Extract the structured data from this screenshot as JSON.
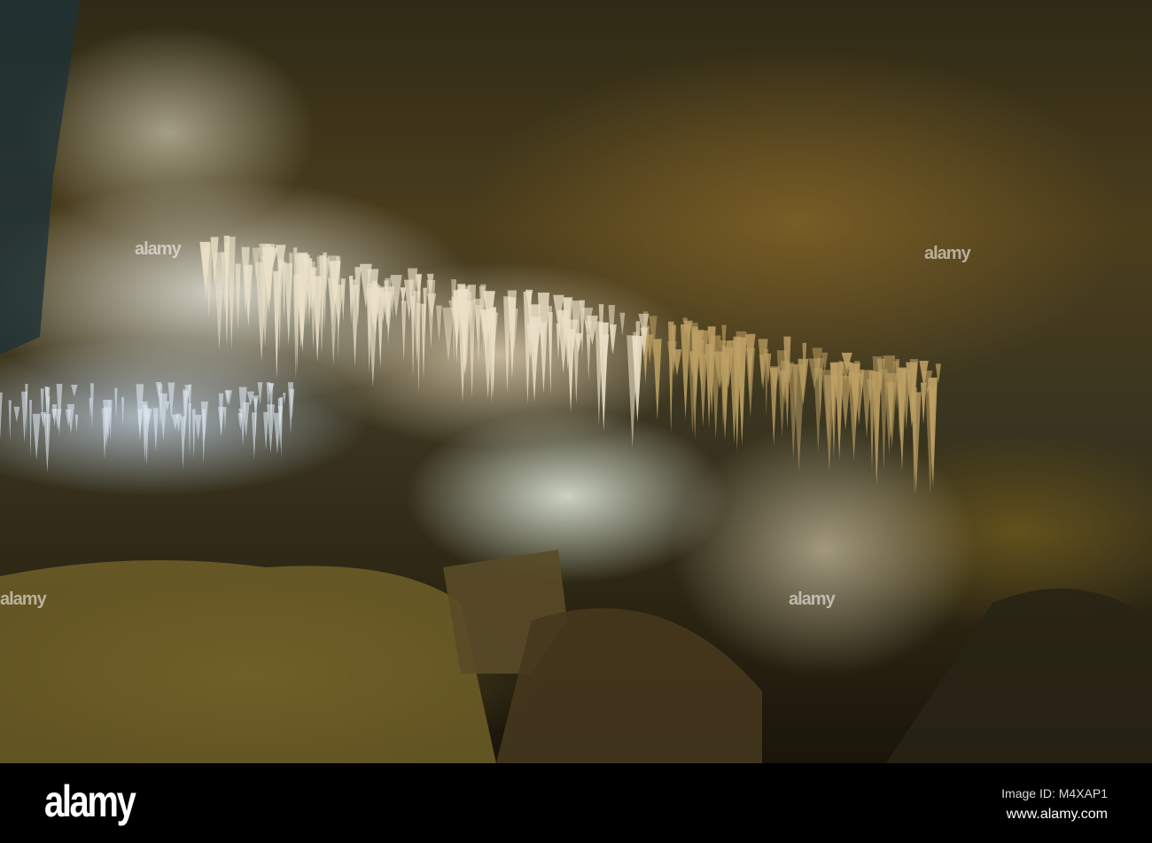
{
  "photo": {
    "subject": "cave"
  },
  "watermark": {
    "logo": "alamy"
  },
  "footer": {
    "logo": "alamy",
    "image_id": "Image ID: M4XAP1",
    "url": "www.alamy.com"
  }
}
